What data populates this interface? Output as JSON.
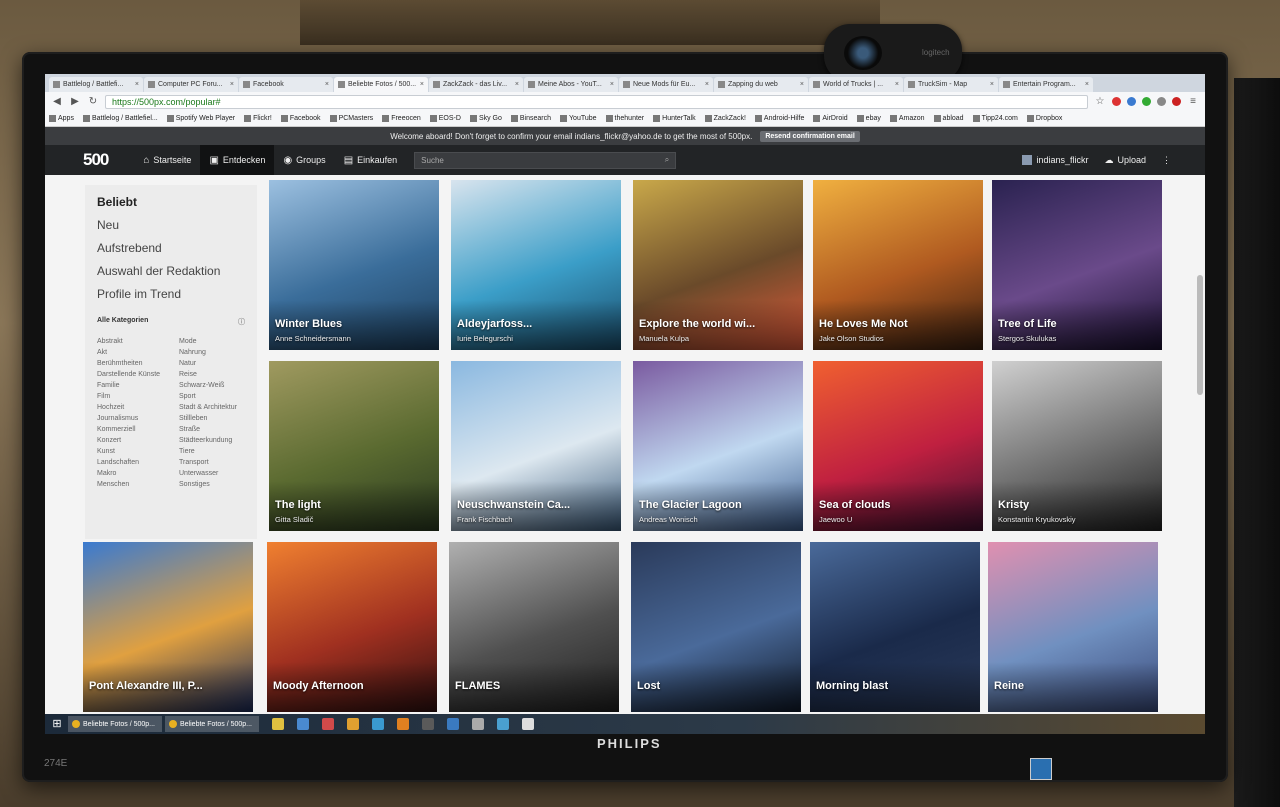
{
  "browser": {
    "tabs": [
      {
        "label": "Battlelog / Battlefi...",
        "active": false
      },
      {
        "label": "Computer PC Foru...",
        "active": false
      },
      {
        "label": "Facebook",
        "active": false
      },
      {
        "label": "Beliebte Fotos / 500...",
        "active": true
      },
      {
        "label": "ZackZack - das Liv...",
        "active": false
      },
      {
        "label": "Meine Abos - YouT...",
        "active": false
      },
      {
        "label": "Neue Mods für Eu...",
        "active": false
      },
      {
        "label": "Zapping du web",
        "active": false
      },
      {
        "label": "World of Trucks | ...",
        "active": false
      },
      {
        "label": "TruckSim - Map",
        "active": false
      },
      {
        "label": "Entertain Program...",
        "active": false
      }
    ],
    "url": "https://500px.com/popular#",
    "bookmarks": [
      "Apps",
      "Battlelog / Battlefiel...",
      "Spotify Web Player",
      "Flickr!",
      "Facebook",
      "PCMasters",
      "Freeocen",
      "EOS-D",
      "Sky Go",
      "Binsearch",
      "YouTube",
      "thehunter",
      "HunterTalk",
      "ZackZack!",
      "Android-Hilfe",
      "AirDroid",
      "ebay",
      "Amazon",
      "abload",
      "Tipp24.com",
      "Dropbox"
    ]
  },
  "notice": {
    "text": "Welcome aboard! Don't forget to confirm your email indians_flickr@yahoo.de to get the most of 500px.",
    "button": "Resend confirmation email"
  },
  "nav": {
    "logo": "500",
    "items": [
      {
        "label": "Startseite",
        "active": false,
        "icon": "home-icon"
      },
      {
        "label": "Entdecken",
        "active": true,
        "icon": "image-icon"
      },
      {
        "label": "Groups",
        "active": false,
        "icon": "groups-icon"
      },
      {
        "label": "Einkaufen",
        "active": false,
        "icon": "shop-icon"
      }
    ],
    "search_placeholder": "Suche",
    "username": "indians_flickr",
    "upload": "Upload"
  },
  "sidebar": {
    "items": [
      {
        "label": "Beliebt",
        "active": true
      },
      {
        "label": "Neu",
        "active": false
      },
      {
        "label": "Aufstrebend",
        "active": false
      },
      {
        "label": "Auswahl der Redaktion",
        "active": false
      },
      {
        "label": "Profile im Trend",
        "active": false
      }
    ],
    "categories_title": "Alle Kategorien",
    "categories": [
      "Abstrakt",
      "Mode",
      "Akt",
      "Nahrung",
      "Berühmtheiten",
      "Natur",
      "Darstellende Künste",
      "Reise",
      "Familie",
      "Schwarz-Weiß",
      "Film",
      "Sport",
      "Hochzeit",
      "Stadt & Architektur",
      "Journalismus",
      "Stillleben",
      "Kommerziell",
      "Straße",
      "Konzert",
      "Städteerkundung",
      "Kunst",
      "Tiere",
      "Landschaften",
      "Transport",
      "Makro",
      "Unterwasser",
      "Menschen",
      "Sonstiges"
    ]
  },
  "photos": [
    {
      "title": "Winter Blues",
      "author": "Anne Schneidersmann",
      "colors": [
        "#9cc0e0",
        "#3a6d9a",
        "#1d3f5e"
      ]
    },
    {
      "title": "Aldeyjarfoss...",
      "author": "Iurie Belegurschi",
      "colors": [
        "#d8e4ee",
        "#3b9ec8",
        "#1a4c6a"
      ]
    },
    {
      "title": "Explore the world wi...",
      "author": "Manuela Kulpa",
      "colors": [
        "#c9a84a",
        "#6a4a2a",
        "#e05a3a"
      ]
    },
    {
      "title": "He Loves Me Not",
      "author": "Jake Olson Studios",
      "colors": [
        "#f0b040",
        "#b05a20",
        "#3a2010"
      ]
    },
    {
      "title": "Tree of Life",
      "author": "Stergos Skulukas",
      "colors": [
        "#2a2250",
        "#6a4a8a",
        "#1a1030"
      ]
    },
    {
      "title": "The light",
      "author": "Gitta Sladič",
      "colors": [
        "#a09a60",
        "#5a6a30",
        "#2a3a20"
      ]
    },
    {
      "title": "Neuschwanstein Ca...",
      "author": "Frank Fischbach",
      "colors": [
        "#8ab8e0",
        "#dde8f0",
        "#3a5a7a"
      ]
    },
    {
      "title": "The Glacier Lagoon",
      "author": "Andreas Wonisch",
      "colors": [
        "#7a5aa0",
        "#c0d8f0",
        "#3a5a8a"
      ]
    },
    {
      "title": "Sea of clouds",
      "author": "Jaewoo U",
      "colors": [
        "#f06030",
        "#c02040",
        "#401030"
      ]
    },
    {
      "title": "Kristy",
      "author": "Konstantin Kryukovskiy",
      "colors": [
        "#d0d0d0",
        "#707070",
        "#202020"
      ]
    },
    {
      "title": "Pont Alexandre III, P...",
      "author": "",
      "colors": [
        "#3a7ad0",
        "#e0a040",
        "#1a2a5a"
      ]
    },
    {
      "title": "Moody Afternoon",
      "author": "",
      "colors": [
        "#f08030",
        "#a03020",
        "#301010"
      ]
    },
    {
      "title": "FLAMES",
      "author": "",
      "colors": [
        "#b0b0b0",
        "#505050",
        "#202020"
      ]
    },
    {
      "title": "Lost",
      "author": "",
      "colors": [
        "#2a3a5a",
        "#4a6a9a",
        "#101a2a"
      ]
    },
    {
      "title": "Morning blast",
      "author": "",
      "colors": [
        "#4a6a9a",
        "#1a2a4a",
        "#2a3a5a"
      ]
    },
    {
      "title": "Reine",
      "author": "",
      "colors": [
        "#e090b0",
        "#7090c0",
        "#3a4a7a"
      ]
    }
  ],
  "taskbar": {
    "tasks": [
      "Beliebte Fotos / 500p...",
      "Beliebte Fotos / 500p..."
    ]
  },
  "monitor": {
    "brand": "PHILIPS",
    "model": "274E",
    "webcam_logo": "logitech"
  }
}
